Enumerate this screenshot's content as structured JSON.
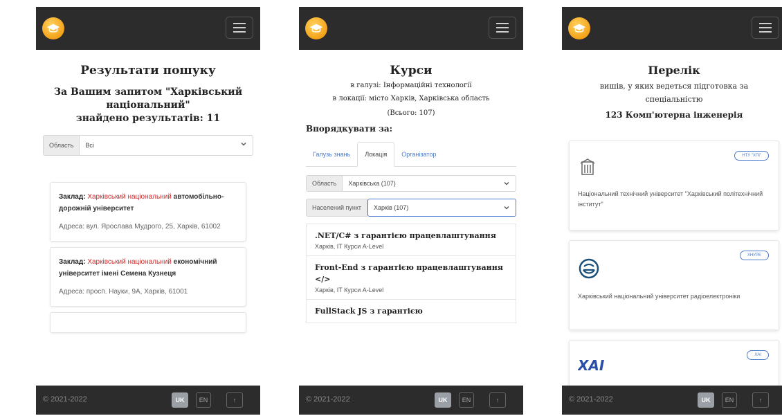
{
  "footer": {
    "copyright": "© 2021-2022",
    "lang_uk": "UK",
    "lang_en": "EN",
    "up": "↑"
  },
  "search": {
    "title": "Результати пошуку",
    "query_line": "За Вашим запитом \"Харківський національний\"",
    "results_line": "знайдено результатів: 11",
    "filter_label": "Область",
    "filter_value": "Всі",
    "results": [
      {
        "key": "Заклад:",
        "name_hl": "Харківський національний",
        "name_rest": "автомобільно-дорожній університет",
        "address": "Адреса: вул. Ярослава Мудрого, 25, Харків, 61002"
      },
      {
        "key": "Заклад:",
        "name_hl": "Харківський національний",
        "name_rest": "економічний університет імені Семена Кузнеця",
        "address": "Адреса: просп. Науки, 9А, Харків, 61001"
      }
    ]
  },
  "courses": {
    "title": "Курси",
    "field_line": "в галузі: Інформаційні технології",
    "location_line": "в локації: місто Харків, Харківська область",
    "total": "(Всього: 107)",
    "sort_label": "Впорядкувати за:",
    "tabs": [
      "Галузь знань",
      "Локація",
      "Організатор"
    ],
    "region_label": "Область",
    "region_value": "Харківська (107)",
    "city_label": "Населений пункт",
    "city_value": "Харків (107)",
    "items": [
      {
        "name": ".NET/C# з гарантією працевлаштування",
        "meta": "Харків, IT Курси A-Level"
      },
      {
        "name": "Front-End з гарантією працевлаштування </>",
        "meta": "Харків, IT Курси A-Level"
      },
      {
        "name": "FullStack JS з гарантією",
        "meta": ""
      }
    ]
  },
  "universities": {
    "title": "Перелік",
    "desc": "вишів, у яких ведеться підготовка за спеціальністю",
    "specialty": "123 Комп'ютерна інженерія",
    "items": [
      {
        "pill": "НТУ \"ХПІ\"",
        "name": "Національний технічний університет \"Харківський політехнічний інститут\"",
        "icon": "building-crest-icon"
      },
      {
        "pill": "ХНУРЕ",
        "name": "Харківський національний університет радіоелектроніки",
        "icon": "nure-logo-icon"
      },
      {
        "pill": "ХАІ",
        "name": "",
        "icon": "khai-logo-icon"
      }
    ]
  },
  "colors": {
    "header": "#2c2c2c",
    "highlight": "#d02a2a",
    "link": "#4a7bd0",
    "logo": "#f4a21a"
  }
}
